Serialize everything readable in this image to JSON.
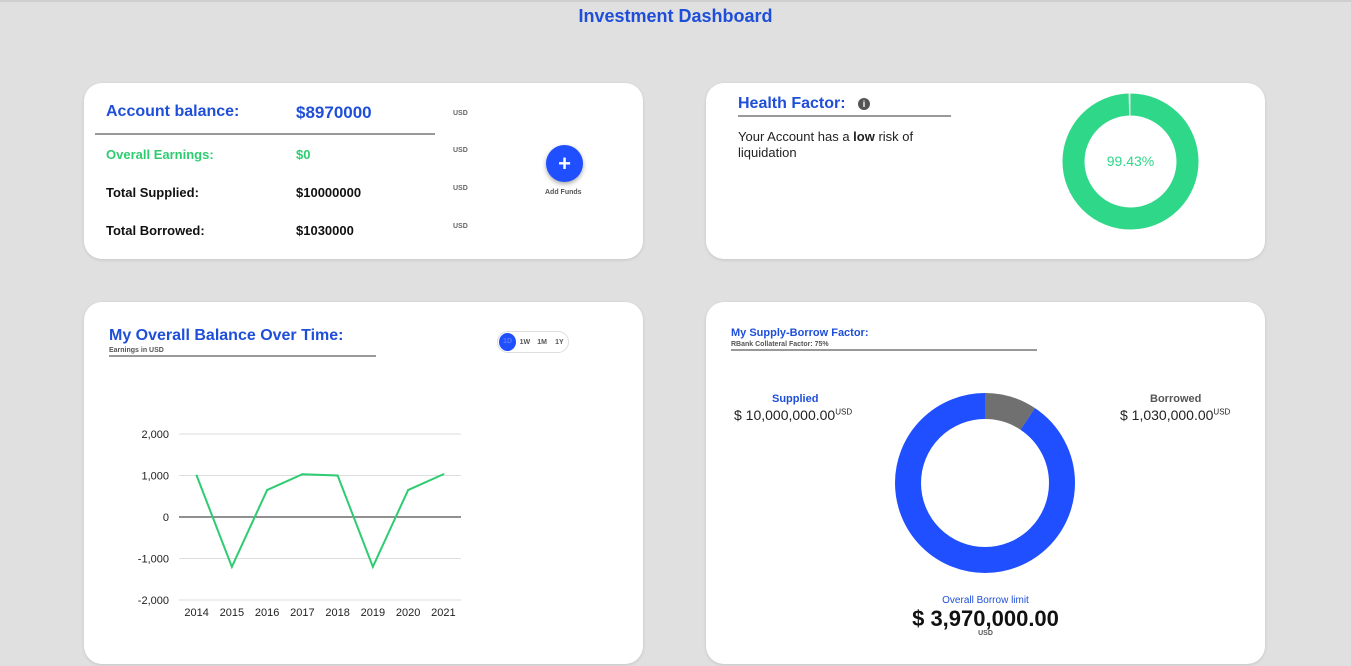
{
  "page": {
    "title": "Investment Dashboard"
  },
  "account": {
    "balance_label": "Account balance:",
    "balance_value": "$8970000",
    "currency": "USD",
    "rows": [
      {
        "label": "Overall Earnings:",
        "value": "$0",
        "currency": "USD"
      },
      {
        "label": "Total Supplied:",
        "value": "$10000000",
        "currency": "USD"
      },
      {
        "label": "Total Borrowed:",
        "value": "$1030000",
        "currency": "USD"
      }
    ],
    "add_button_icon": "plus-icon",
    "add_button_glyph": "+",
    "add_label": "Add Funds"
  },
  "health": {
    "title": "Health Factor:",
    "info_glyph": "i",
    "text_prefix": "Your Account has a ",
    "text_bold": "low",
    "text_suffix": " risk of liquidation",
    "percent_label": "99.43%",
    "percent": 99.43,
    "colors": {
      "fill": "#2ed888",
      "text": "#2ed888"
    }
  },
  "balance_chart": {
    "title": "My Overall Balance Over Time:",
    "subtitle": "Earnings in USD",
    "ranges": [
      "1D",
      "1W",
      "1M",
      "1Y"
    ],
    "active_range": "1D"
  },
  "chart_data": {
    "type": "line",
    "x": [
      "2014",
      "2015",
      "2016",
      "2017",
      "2018",
      "2019",
      "2020",
      "2021"
    ],
    "series": [
      {
        "values": [
          1000,
          -1200,
          650,
          1030,
          1000,
          -1200,
          650,
          1030
        ],
        "color": "#2ecc71"
      }
    ],
    "ylim": [
      -2000,
      2000
    ],
    "yticks": [
      2000,
      1000,
      0,
      -1000,
      -2000
    ],
    "ytick_labels": [
      "2,000",
      "1,000",
      "0",
      "-1,000",
      "-2,000"
    ],
    "grid": true
  },
  "factor": {
    "title": "My Supply-Borrow Factor:",
    "subtitle": "RBank Collateral Factor: 75%",
    "supplied_label": "Supplied",
    "supplied_value": "$ 10,000,000.00",
    "borrowed_label": "Borrowed",
    "borrowed_value": "$ 1,030,000.00",
    "currency": "USD",
    "limit_label": "Overall Borrow limit",
    "limit_value": "$ 3,970,000.00",
    "supplied_amount": 10000000,
    "borrowed_amount": 1030000,
    "colors": {
      "supplied": "#1f4fff",
      "borrowed": "#707070"
    }
  }
}
